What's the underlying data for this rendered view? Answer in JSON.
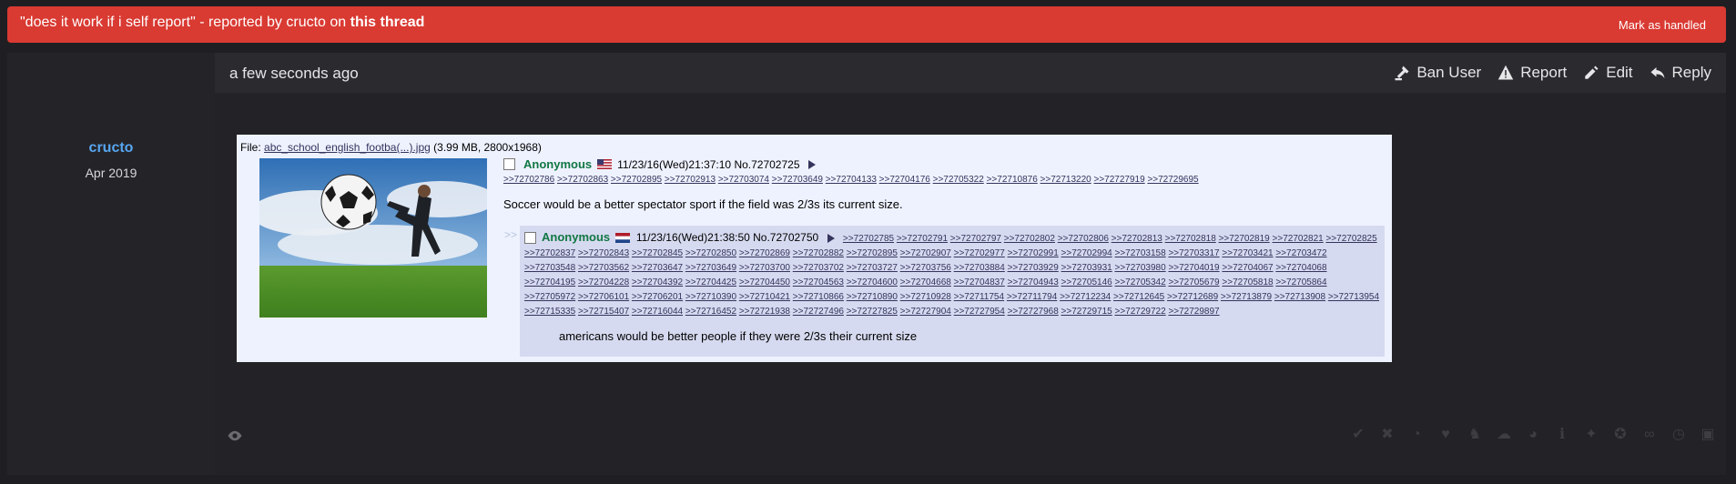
{
  "banner": {
    "message_prefix": "\"does it work if i self report\" - reported by cructo on ",
    "message_link": "this thread",
    "handled_label": "Mark as handled"
  },
  "author": {
    "name": "cructo",
    "joined": "Apr 2019"
  },
  "post": {
    "timestamp": "a few seconds ago",
    "actions": {
      "ban": "Ban User",
      "report": "Report",
      "edit": "Edit",
      "reply": "Reply"
    }
  },
  "screenshot": {
    "file_label": "File: ",
    "file_name": "abc_school_english_footba(...).jpg",
    "file_meta": " (3.99 MB, 2800x1968)",
    "op": {
      "name": "Anonymous",
      "datetime": "11/23/16(Wed)21:37:10 No.72702725",
      "quotelinks": [
        ">>72702786",
        ">>72702863",
        ">>72702895",
        ">>72702913",
        ">>72703074",
        ">>72703649",
        ">>72704133",
        ">>72704176",
        ">>72705322",
        ">>72710876",
        ">>72713220",
        ">>72727919",
        ">>72729695"
      ],
      "body": "Soccer would be a better spectator sport if the field was 2/3s its current size."
    },
    "reply_arrows": ">>",
    "reply": {
      "name": "Anonymous",
      "datetime": "11/23/16(Wed)21:38:50 No.72702750",
      "quotelinks": [
        ">>72702785",
        ">>72702791",
        ">>72702797",
        ">>72702802",
        ">>72702806",
        ">>72702813",
        ">>72702818",
        ">>72702819",
        ">>72702821",
        ">>72702825",
        ">>72702837",
        ">>72702843",
        ">>72702845",
        ">>72702850",
        ">>72702869",
        ">>72702882",
        ">>72702895",
        ">>72702907",
        ">>72702977",
        ">>72702991",
        ">>72702994",
        ">>72703158",
        ">>72703317",
        ">>72703421",
        ">>72703472",
        ">>72703548",
        ">>72703562",
        ">>72703647",
        ">>72703649",
        ">>72703700",
        ">>72703702",
        ">>72703727",
        ">>72703756",
        ">>72703884",
        ">>72703929",
        ">>72703931",
        ">>72703980",
        ">>72704019",
        ">>72704067",
        ">>72704068",
        ">>72704195",
        ">>72704228",
        ">>72704392",
        ">>72704425",
        ">>72704450",
        ">>72704563",
        ">>72704600",
        ">>72704668",
        ">>72704837",
        ">>72704943",
        ">>72705146",
        ">>72705342",
        ">>72705679",
        ">>72705818",
        ">>72705864",
        ">>72705972",
        ">>72706101",
        ">>72706201",
        ">>72710390",
        ">>72710421",
        ">>72710866",
        ">>72710890",
        ">>72710928",
        ">>72711754",
        ">>72711794",
        ">>72712234",
        ">>72712645",
        ">>72712689",
        ">>72713879",
        ">>72713908",
        ">>72713954",
        ">>72715335",
        ">>72715407",
        ">>72716044",
        ">>72716452",
        ">>72721938",
        ">>72727496",
        ">>72727825",
        ">>72727904",
        ">>72727954",
        ">>72727968",
        ">>72729715",
        ">>72729722",
        ">>72729897"
      ],
      "body": "americans would be better people if they were 2/3s their current size"
    }
  },
  "reactions": [
    "check-icon",
    "cross-icon",
    "pacman-icon",
    "heart-icon",
    "horse-icon",
    "rain-cloud-icon",
    "palette-icon",
    "info-icon",
    "lightbulb-icon",
    "medal-icon",
    "glasses-icon",
    "clock-icon",
    "box-icon"
  ],
  "colors": {
    "banner": "#d93a32",
    "username": "#58a6f0",
    "anon_name": "#117743",
    "link": "#34345c"
  }
}
